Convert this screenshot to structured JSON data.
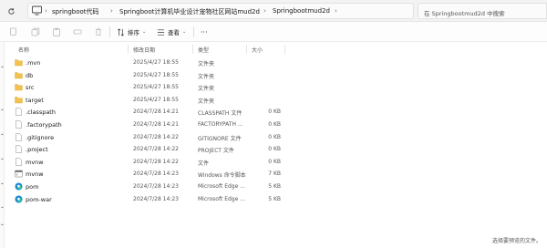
{
  "address_bar": {
    "crumbs": [
      "springboot代码",
      "Springboot计算机毕业设计宠物社区网站mud2d",
      "Springbootmud2d"
    ],
    "search_placeholder": "在 Springbootmud2d 中搜索"
  },
  "toolbar": {
    "sort_label": "排序",
    "view_label": "查看",
    "more_label": "···"
  },
  "columns": {
    "name": "名称",
    "date": "修改日期",
    "type": "类型",
    "size": "大小"
  },
  "files": [
    {
      "name": ".mvn",
      "date": "2025/4/27 18:55",
      "type": "文件夹",
      "size": "",
      "icon": "folder-icon"
    },
    {
      "name": "db",
      "date": "2025/4/27 18:55",
      "type": "文件夹",
      "size": "",
      "icon": "folder-icon"
    },
    {
      "name": "src",
      "date": "2025/4/27 18:55",
      "type": "文件夹",
      "size": "",
      "icon": "folder-icon"
    },
    {
      "name": "target",
      "date": "2025/4/27 18:55",
      "type": "文件夹",
      "size": "",
      "icon": "folder-icon"
    },
    {
      "name": ".classpath",
      "date": "2024/7/28 14:21",
      "type": "CLASSPATH 文件",
      "size": "0 KB",
      "icon": "file-icon"
    },
    {
      "name": ".factorypath",
      "date": "2024/7/28 14:21",
      "type": "FACTORYPATH ...",
      "size": "0 KB",
      "icon": "file-icon"
    },
    {
      "name": ".gitignore",
      "date": "2024/7/28 14:22",
      "type": "GITIGNORE 文件",
      "size": "0 KB",
      "icon": "file-icon"
    },
    {
      "name": ".project",
      "date": "2024/7/28 14:22",
      "type": "PROJECT 文件",
      "size": "0 KB",
      "icon": "file-icon"
    },
    {
      "name": "mvnw",
      "date": "2024/7/28 14:22",
      "type": "文件",
      "size": "0 KB",
      "icon": "file-icon"
    },
    {
      "name": "mvnw",
      "date": "2024/7/28 14:23",
      "type": "Windows 命令脚本",
      "size": "7 KB",
      "icon": "script-icon"
    },
    {
      "name": "pom",
      "date": "2024/7/28 14:23",
      "type": "Microsoft Edge ...",
      "size": "5 KB",
      "icon": "edge-icon"
    },
    {
      "name": "pom-war",
      "date": "2024/7/28 14:23",
      "type": "Microsoft Edge ...",
      "size": "5 KB",
      "icon": "edge-icon"
    }
  ],
  "status_bar": {
    "preview_text": "选择要预览的文件。"
  }
}
